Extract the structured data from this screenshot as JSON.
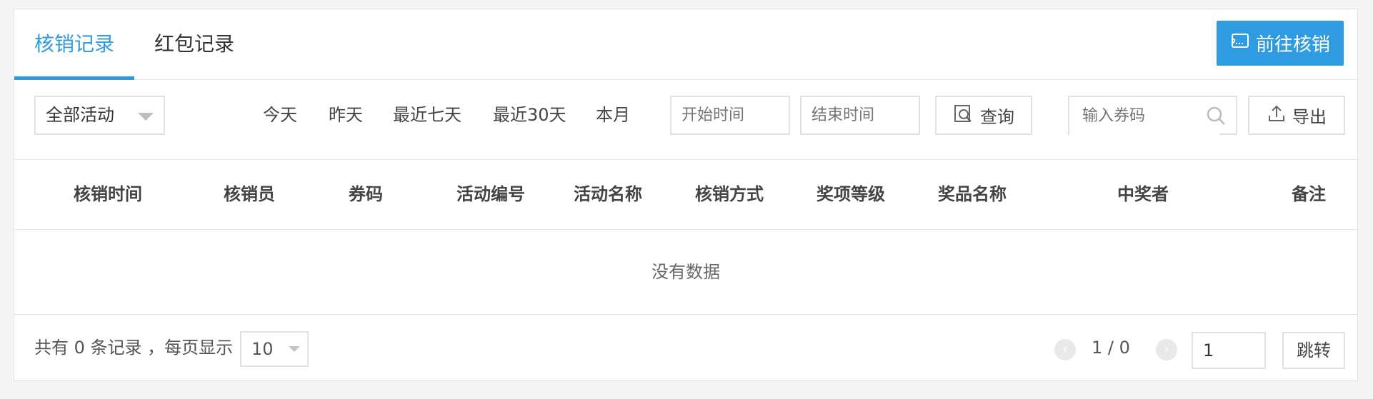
{
  "tabs": [
    {
      "label": "核销记录",
      "active": true
    },
    {
      "label": "红包记录",
      "active": false
    }
  ],
  "go_button": {
    "label": "前往核销",
    "icon": "ticket-icon"
  },
  "filters": {
    "activity_select": "全部活动",
    "quick_ranges": [
      "今天",
      "昨天",
      "最近七天",
      "最近30天",
      "本月"
    ],
    "start_placeholder": "开始时间",
    "end_placeholder": "结束时间",
    "query_label": "查询",
    "code_placeholder": "输入券码",
    "export_label": "导出"
  },
  "table": {
    "columns": [
      "核销时间",
      "核销员",
      "券码",
      "活动编号",
      "活动名称",
      "核销方式",
      "奖项等级",
      "奖品名称",
      "中奖者",
      "备注"
    ],
    "empty_text": "没有数据"
  },
  "footer": {
    "total_text": "共有 0 条记录 ，每页显示",
    "page_size": "10",
    "page_indicator": "1 / 0",
    "jump_value": "1",
    "jump_label": "跳转"
  },
  "colors": {
    "accent": "#2f9be0"
  }
}
